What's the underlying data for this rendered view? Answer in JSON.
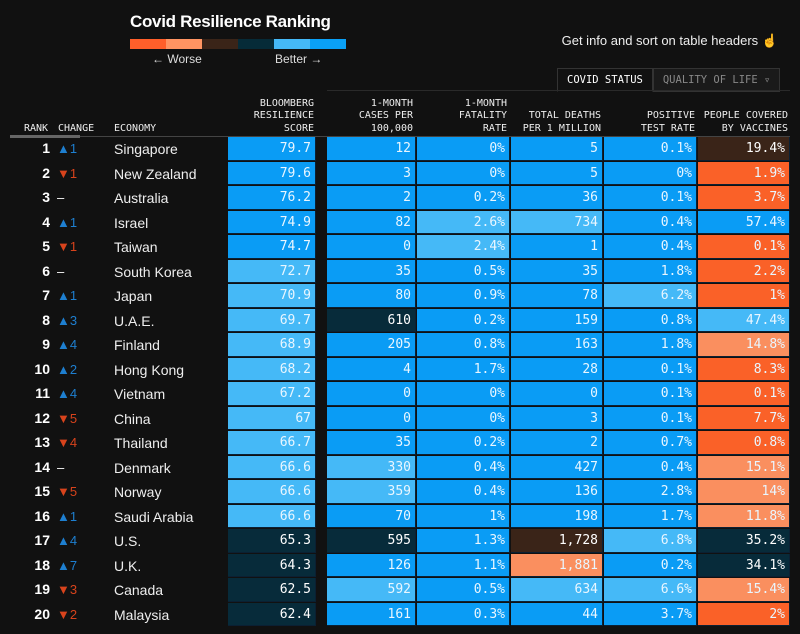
{
  "title": "Covid Resilience Ranking",
  "legend": {
    "worse_label": "← Worse",
    "better_label": "Better →",
    "colors": [
      "#ff5f2a",
      "#ff9462",
      "#3a2418",
      "#062b38",
      "#45b9f7",
      "#0aa0f6"
    ]
  },
  "info_text": "Get info and sort on table headers",
  "info_icon": "pointer-hand-icon",
  "tabs": [
    {
      "label": "COVID STATUS",
      "active": true
    },
    {
      "label": "QUALITY OF LIFE ▿",
      "active": false
    }
  ],
  "headers": {
    "rank": "RANK",
    "change": "CHANGE",
    "economy": "ECONOMY",
    "score": "BLOOMBERG RESILIENCE SCORE",
    "cases": "1-MONTH CASES PER 100,000",
    "fatality": "1-MONTH FATALITY RATE",
    "deaths": "TOTAL DEATHS PER 1 MILLION",
    "positive": "POSITIVE TEST RATE",
    "vaccines": "PEOPLE COVERED BY VACCINES"
  },
  "palette": {
    "B": "#0a9cf5",
    "L": "#45b9f7",
    "D": "#072b3a",
    "K": "#3a2418",
    "O": "#fa6128",
    "P": "#fa8f5f",
    "up": "#1e7fd0",
    "down": "#d8431c"
  },
  "rows": [
    {
      "rank": "1",
      "change": "▲1",
      "economy": "Singapore",
      "values": [
        "79.7",
        "12",
        "0%",
        "5",
        "0.1%",
        "19.4%"
      ],
      "colors": "BBBBBK"
    },
    {
      "rank": "2",
      "change": "▼1",
      "economy": "New Zealand",
      "values": [
        "79.6",
        "3",
        "0%",
        "5",
        "0%",
        "1.9%"
      ],
      "colors": "BBBBBO"
    },
    {
      "rank": "3",
      "change": "–",
      "economy": "Australia",
      "values": [
        "76.2",
        "2",
        "0.2%",
        "36",
        "0.1%",
        "3.7%"
      ],
      "colors": "BBBBBO"
    },
    {
      "rank": "4",
      "change": "▲1",
      "economy": "Israel",
      "values": [
        "74.9",
        "82",
        "2.6%",
        "734",
        "0.4%",
        "57.4%"
      ],
      "colors": "BBLLBB"
    },
    {
      "rank": "5",
      "change": "▼1",
      "economy": "Taiwan",
      "values": [
        "74.7",
        "0",
        "2.4%",
        "1",
        "0.4%",
        "0.1%"
      ],
      "colors": "BBLBBO"
    },
    {
      "rank": "6",
      "change": "–",
      "economy": "South Korea",
      "values": [
        "72.7",
        "35",
        "0.5%",
        "35",
        "1.8%",
        "2.2%"
      ],
      "colors": "LBBBBO"
    },
    {
      "rank": "7",
      "change": "▲1",
      "economy": "Japan",
      "values": [
        "70.9",
        "80",
        "0.9%",
        "78",
        "6.2%",
        "1%"
      ],
      "colors": "LBBBLO"
    },
    {
      "rank": "8",
      "change": "▲3",
      "economy": "U.A.E.",
      "values": [
        "69.7",
        "610",
        "0.2%",
        "159",
        "0.8%",
        "47.4%"
      ],
      "colors": "LDBBBL"
    },
    {
      "rank": "9",
      "change": "▲4",
      "economy": "Finland",
      "values": [
        "68.9",
        "205",
        "0.8%",
        "163",
        "1.8%",
        "14.8%"
      ],
      "colors": "LBBBBP"
    },
    {
      "rank": "10",
      "change": "▲2",
      "economy": "Hong Kong",
      "values": [
        "68.2",
        "4",
        "1.7%",
        "28",
        "0.1%",
        "8.3%"
      ],
      "colors": "LBBBBO"
    },
    {
      "rank": "11",
      "change": "▲4",
      "economy": "Vietnam",
      "values": [
        "67.2",
        "0",
        "0%",
        "0",
        "0.1%",
        "0.1%"
      ],
      "colors": "LBBBBO"
    },
    {
      "rank": "12",
      "change": "▼5",
      "economy": "China",
      "values": [
        "67",
        "0",
        "0%",
        "3",
        "0.1%",
        "7.7%"
      ],
      "colors": "LBBBBO"
    },
    {
      "rank": "13",
      "change": "▼4",
      "economy": "Thailand",
      "values": [
        "66.7",
        "35",
        "0.2%",
        "2",
        "0.7%",
        "0.8%"
      ],
      "colors": "LBBBBO"
    },
    {
      "rank": "14",
      "change": "–",
      "economy": "Denmark",
      "values": [
        "66.6",
        "330",
        "0.4%",
        "427",
        "0.4%",
        "15.1%"
      ],
      "colors": "LLBBBP"
    },
    {
      "rank": "15",
      "change": "▼5",
      "economy": "Norway",
      "values": [
        "66.6",
        "359",
        "0.4%",
        "136",
        "2.8%",
        "14%"
      ],
      "colors": "LLBBBP"
    },
    {
      "rank": "16",
      "change": "▲1",
      "economy": "Saudi Arabia",
      "values": [
        "66.6",
        "70",
        "1%",
        "198",
        "1.7%",
        "11.8%"
      ],
      "colors": "LBBBBP"
    },
    {
      "rank": "17",
      "change": "▲4",
      "economy": "U.S.",
      "values": [
        "65.3",
        "595",
        "1.3%",
        "1,728",
        "6.8%",
        "35.2%"
      ],
      "colors": "DDBKLD"
    },
    {
      "rank": "18",
      "change": "▲7",
      "economy": "U.K.",
      "values": [
        "64.3",
        "126",
        "1.1%",
        "1,881",
        "0.2%",
        "34.1%"
      ],
      "colors": "DBBPBD"
    },
    {
      "rank": "19",
      "change": "▼3",
      "economy": "Canada",
      "values": [
        "62.5",
        "592",
        "0.5%",
        "634",
        "6.6%",
        "15.4%"
      ],
      "colors": "DLBLLP"
    },
    {
      "rank": "20",
      "change": "▼2",
      "economy": "Malaysia",
      "values": [
        "62.4",
        "161",
        "0.3%",
        "44",
        "3.7%",
        "2%"
      ],
      "colors": "DBBBBO"
    }
  ]
}
